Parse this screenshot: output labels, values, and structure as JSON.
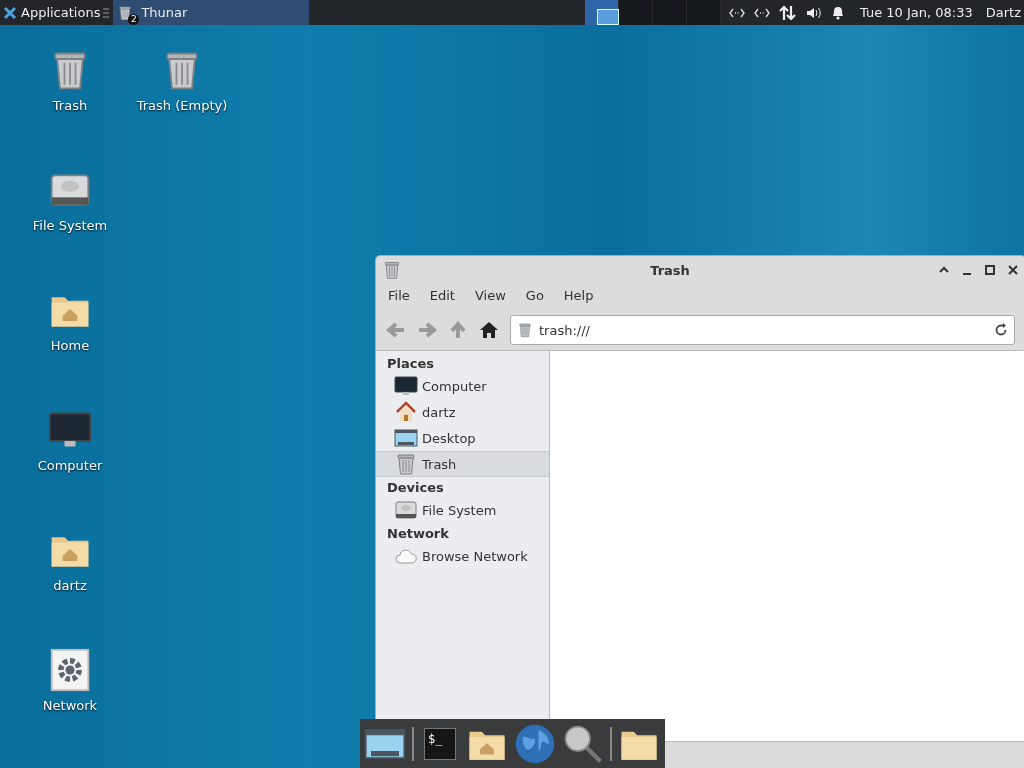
{
  "panel": {
    "apps_menu": "Applications",
    "tasks": [
      {
        "title": "Thunar",
        "count": "2",
        "selected": true
      }
    ],
    "workspaces": [
      {
        "selected": true
      },
      {
        "selected": false
      },
      {
        "selected": false
      },
      {
        "selected": false
      }
    ],
    "clock": "Tue 10 Jan, 08:33",
    "user": "Dartz"
  },
  "desktop_icons": [
    {
      "label": "Trash",
      "kind": "trash"
    },
    {
      "label": "Trash (Empty)",
      "kind": "trash"
    },
    {
      "label": "File System",
      "kind": "drive"
    },
    {
      "label": "Home",
      "kind": "home-folder"
    },
    {
      "label": "Computer",
      "kind": "computer"
    },
    {
      "label": "dartz",
      "kind": "home-folder"
    },
    {
      "label": "Network",
      "kind": "settings"
    }
  ],
  "window": {
    "title": "Trash",
    "menu": [
      "File",
      "Edit",
      "View",
      "Go",
      "Help"
    ],
    "location": "trash:///",
    "sidebar": [
      {
        "heading": "Places",
        "items": [
          {
            "label": "Computer",
            "kind": "computer",
            "selected": false
          },
          {
            "label": "dartz",
            "kind": "house",
            "selected": false
          },
          {
            "label": "Desktop",
            "kind": "desktop",
            "selected": false
          },
          {
            "label": "Trash",
            "kind": "trash",
            "selected": true
          }
        ]
      },
      {
        "heading": "Devices",
        "items": [
          {
            "label": "File System",
            "kind": "drive",
            "selected": false
          }
        ]
      },
      {
        "heading": "Network",
        "items": [
          {
            "label": "Browse Network",
            "kind": "cloud",
            "selected": false
          }
        ]
      }
    ]
  },
  "dock": [
    [
      {
        "kind": "desktop"
      }
    ],
    [
      {
        "kind": "terminal",
        "glyph": "$_"
      },
      {
        "kind": "home-folder"
      },
      {
        "kind": "globe"
      },
      {
        "kind": "magnifier"
      }
    ],
    [
      {
        "kind": "folder"
      }
    ]
  ]
}
